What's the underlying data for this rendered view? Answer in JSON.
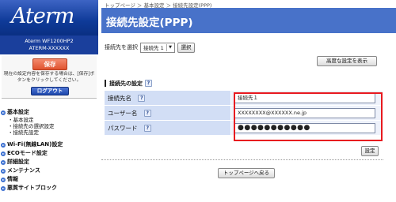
{
  "brand": {
    "logo_text": "Aterm",
    "model": "Aterm  WF1200HP2",
    "device_id": "ATERM-XXXXXX"
  },
  "sidebar": {
    "save_label": "保存",
    "save_message": "現在の設定内容を保存する場合は、[保存]ボタンをクリックしてください。",
    "logout_label": "ログアウト",
    "basic_section": "基本設定",
    "basic_items": [
      "・基本設定",
      "・接続先の選択設定",
      "・接続先設定"
    ],
    "sections": [
      "Wi-Fi(無線LAN)設定",
      "ECOモード設定",
      "詳細設定",
      "メンテナンス",
      "情報",
      "悪質サイトブロック"
    ]
  },
  "main": {
    "breadcrumb": "トップページ ＞ 基本設定 ＞ 接続先設定(PPP)",
    "title": "接続先設定(PPP)",
    "select_label": "接続先を選択",
    "select_value": "接続先 1",
    "select_button": "選択",
    "advanced_button": "高度な設定を表示",
    "section_title": "接続先の設定",
    "help_label": "?",
    "fields": [
      {
        "label": "接続先名",
        "value": "接続先１"
      },
      {
        "label": "ユーザー名",
        "value": "XXXXXXXX@XXXXXX.ne.jp"
      },
      {
        "label": "パスワード",
        "value": "●●●●●●●●●●●"
      }
    ],
    "set_button": "設定",
    "top_page_button": "トップページへ戻る"
  },
  "colors": {
    "title_bar": "#4872c9",
    "highlight": "#e8191f",
    "save_button": "#e0532f"
  }
}
